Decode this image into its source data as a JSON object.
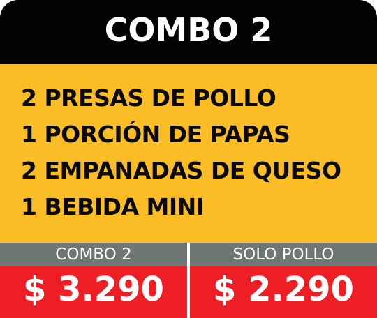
{
  "header": {
    "title": "COMBO 2"
  },
  "items": [
    "2 PRESAS DE POLLO",
    "1 PORCIÓN DE PAPAS",
    "2 EMPANADAS DE QUESO",
    "1 BEBIDA MINI"
  ],
  "prices": [
    {
      "label": "COMBO 2",
      "value": "$ 3.290"
    },
    {
      "label": "SOLO POLLO",
      "value": "$ 2.290"
    }
  ],
  "colors": {
    "background": "#fbbd25",
    "header": "#020202",
    "label_bar": "#6f7775",
    "price_box": "#ed1f24",
    "text_light": "#ffffff",
    "text_dark": "#0a0a0a"
  }
}
